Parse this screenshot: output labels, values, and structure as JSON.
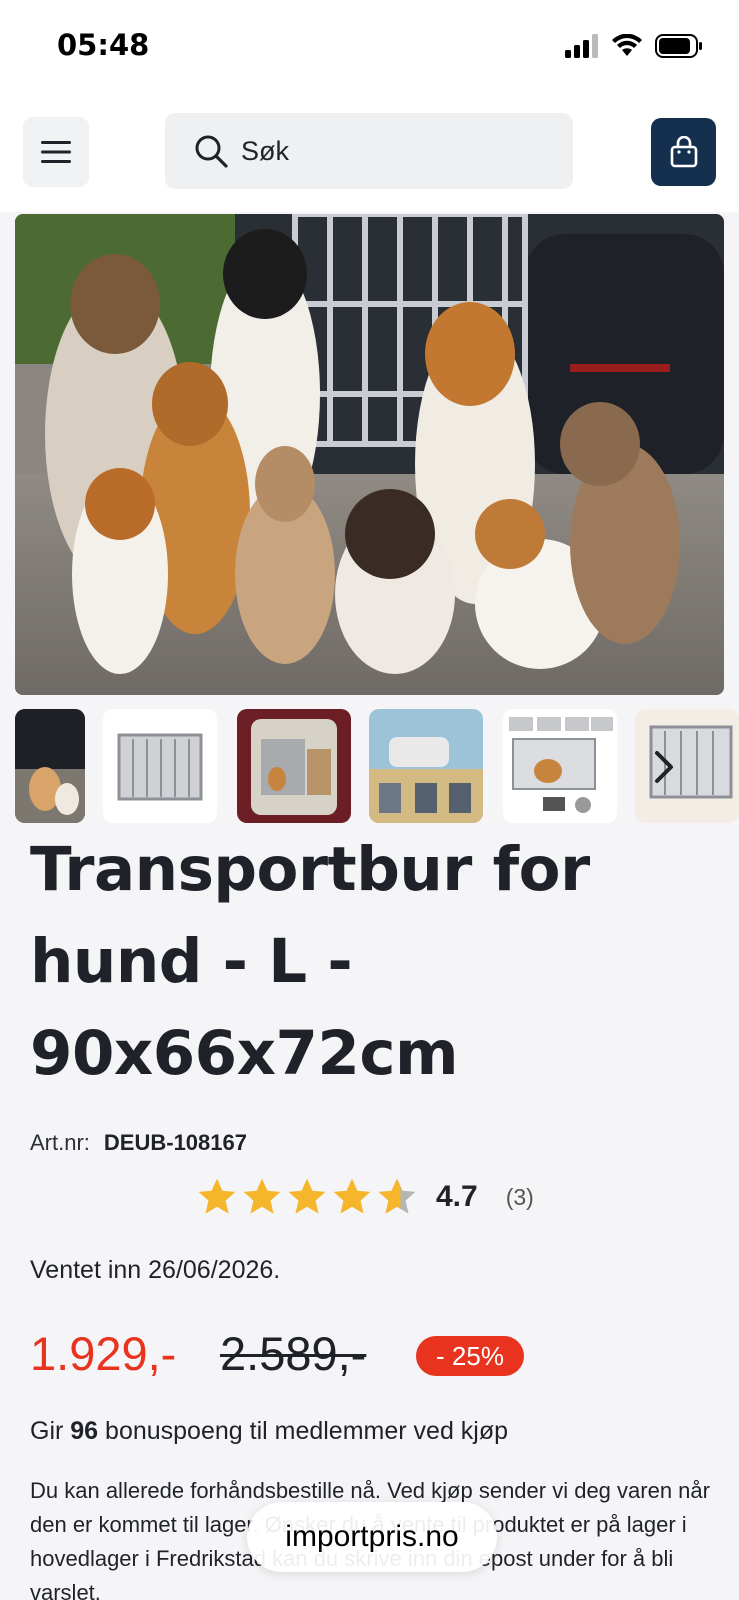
{
  "status_bar": {
    "time": "05:48"
  },
  "header": {
    "search_placeholder": "Søk"
  },
  "product": {
    "title": "Transportbur for hund - L - 90x66x72cm",
    "artnr_label": "Art.nr:",
    "artnr_value": "DEUB-108167",
    "rating_value": "4.7",
    "rating_count": "(3)",
    "expected": "Ventet inn 26/06/2026.",
    "price_now": "1.929,-",
    "price_old": "2.589,-",
    "discount": "- 25%",
    "bonus_prefix": "Gir ",
    "bonus_points": "96",
    "bonus_suffix": " bonuspoeng til medlemmer ved kjøp",
    "description": "Du kan allerede forhåndsbestille nå. Ved kjøp sender vi deg varen når den er kommet til lager. Ønsker du å vente til produktet er på lager i hovedlager i Fredrikstad kan du skrive inn din epost under for å bli varslet."
  },
  "browser": {
    "site": "importpris.no"
  },
  "colors": {
    "accent_red": "#e8341f",
    "cart_navy": "#15304f",
    "star_gold": "#f5b62c"
  }
}
